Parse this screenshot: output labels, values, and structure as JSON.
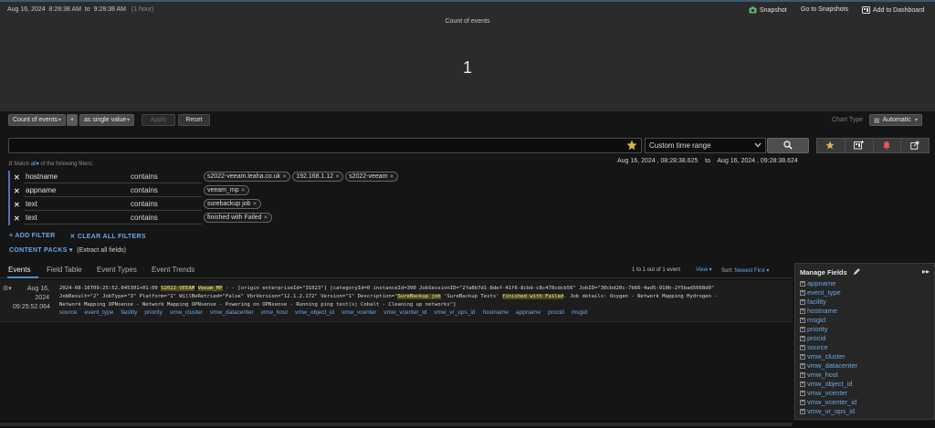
{
  "header": {
    "date": "Aug 16, 2024",
    "start_time": "8:28:38 AM",
    "to": "to",
    "end_time": "9:28:38 AM",
    "duration": "(1 hour)",
    "snapshot": "Snapshot",
    "go_to_snapshots": "Go to Snapshots",
    "add_to_dashboard": "Add to Dashboard"
  },
  "chart": {
    "title": "Count of events",
    "value": "1"
  },
  "controls": {
    "metric": "Count of events",
    "plus": "+",
    "display_mode": "as single value",
    "apply": "Apply",
    "reset": "Reset",
    "chart_type_label": "Chart Type",
    "chart_type_value": "Automatic"
  },
  "search": {
    "placeholder": "",
    "time_range": "Custom time range",
    "range_start": "Aug 16, 2024 , 08:28:38.625",
    "range_to": "to",
    "range_end": "Aug 16, 2024 , 09:28:38.624"
  },
  "match": {
    "prefix": "Match",
    "mode": "all",
    "suffix": "of the following filters:"
  },
  "filters": [
    {
      "field": "hostname",
      "operator": "contains",
      "values": [
        "s2022-veeam.leaha.co.uk",
        "192.168.1.12",
        "s2022-veeam"
      ]
    },
    {
      "field": "appname",
      "operator": "contains",
      "values": [
        "veeam_mp"
      ]
    },
    {
      "field": "text",
      "operator": "contains",
      "values": [
        "surebackup job"
      ]
    },
    {
      "field": "text",
      "operator": "contains",
      "values": [
        "finished with Failed"
      ]
    }
  ],
  "filter_actions": {
    "add": "+ ADD FILTER",
    "clear": "✕ CLEAR ALL FILTERS",
    "content_packs": "CONTENT PACKS",
    "content_packs_note": "(Extract all fields)"
  },
  "tabs": [
    "Events",
    "Field Table",
    "Event Types",
    "Event Trends"
  ],
  "pager": {
    "text": "1 to 1 out of 1 event",
    "view": "View",
    "sort_label": "Sort:",
    "sort_value": "Newest First"
  },
  "event": {
    "date": "Aug 16, 2024",
    "time": "09:25:52.064",
    "text_parts": [
      "2024-08-16T09:25:52.045301+01:00 ",
      "S2022-VEEAM",
      " ",
      "Veeam_MP",
      " - - [origin enterpriseId=\"31023\"] [categoryId=0 instanceId=390 JobSessionID=\"2fa8b7d1-8def-41f6-8cbd-c8c478cdcb56\" JobID=\"30cbd20c-7b66-4ad5-910b-2f5bad5668d0\"\nJobResult=\"2\" JobType=\"3\" Platform=\"1\" WillBeRetried=\"False\" VbrVersion=\"12.1.2.172\" Version=\"1\" Description=\"",
      "SureBackup job",
      " 'SureBackup Tests' ",
      "finished with Failed",
      ". Job details: Oxygen - Network Mapping Hydrogen -\nNetwork Mapping OPNsense - Network Mapping OPNsense - Powering on OPNsense - Running ping test(s) Cobalt - Cleaning up networks\"]"
    ],
    "fields": [
      "source",
      "event_type",
      "facility",
      "priority",
      "vmw_cluster",
      "vmw_datacenter",
      "vmw_host",
      "vmw_object_id",
      "vmw_vcenter",
      "vmw_vcenter_id",
      "vmw_vr_ops_id",
      "hostname",
      "appname",
      "procid",
      "msgid"
    ]
  },
  "manage_fields": {
    "title": "Manage Fields",
    "items": [
      "appname",
      "event_type",
      "facility",
      "hostname",
      "msgid",
      "priority",
      "procid",
      "source",
      "vmw_cluster",
      "vmw_datacenter",
      "vmw_host",
      "vmw_object_id",
      "vmw_vcenter",
      "vmw_vcenter_id",
      "vmw_vr_ops_id"
    ]
  },
  "colors": {
    "link": "#6aa8e8",
    "highlight_bg": "#4c4a1c",
    "highlight_text": "#f3e79a",
    "filter_bar": "#4a77a7"
  }
}
